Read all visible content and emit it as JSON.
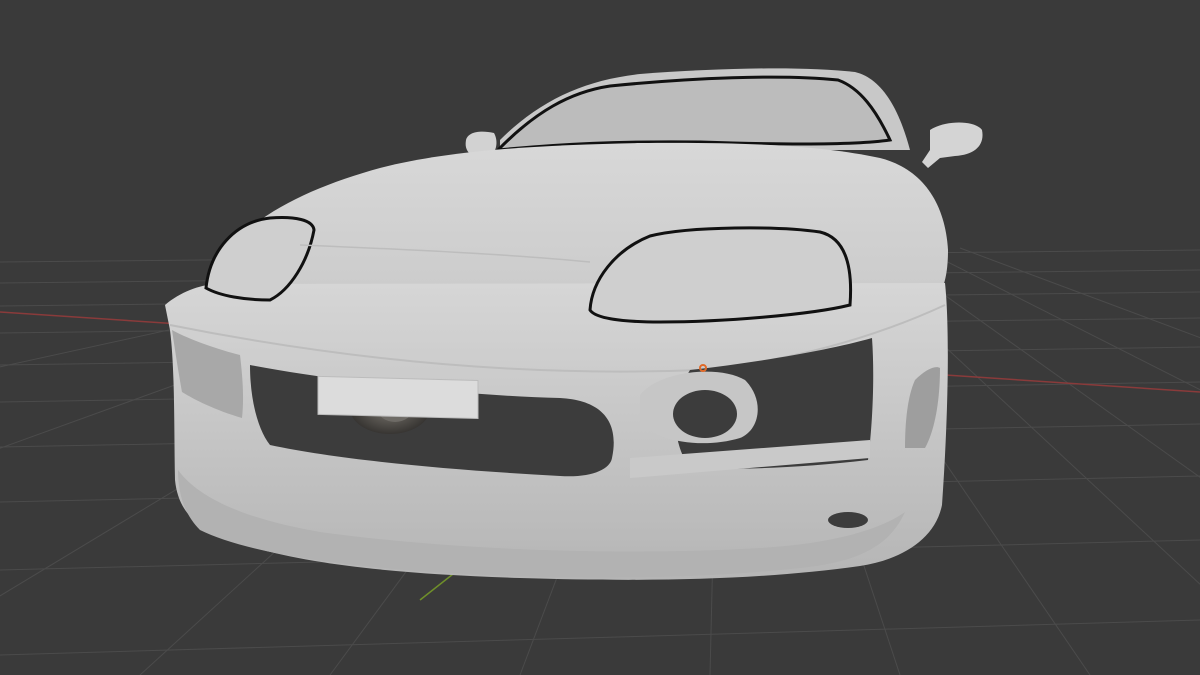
{
  "viewport": {
    "background_color": "#3a3a3a",
    "grid_color": "#4b4b4b",
    "x_axis_color": "#8a3b3b",
    "y_axis_color": "#6f8f2a"
  },
  "scene_object": {
    "material_color": "#cfcfcf",
    "shadow_color": "#9f9f9f",
    "outline_color": "#111111",
    "origin_marker_color": "#e06a2a"
  }
}
